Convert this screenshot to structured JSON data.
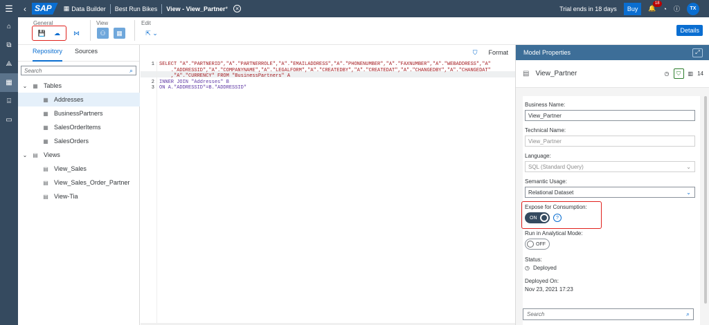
{
  "shell": {
    "logo": "SAP",
    "app": "Data Builder",
    "space": "Best Run Bikes",
    "view_title": "View - View_Partner",
    "view_modified": "*",
    "trial": "Trial ends in 18 days",
    "buy": "Buy",
    "notif_count": "18",
    "user": "TX"
  },
  "toolbar": {
    "general_label": "General",
    "view_label": "View",
    "edit_label": "Edit",
    "details": "Details"
  },
  "repo": {
    "tabs": [
      "Repository",
      "Sources"
    ],
    "search_placeholder": "Search",
    "tables_label": "Tables",
    "tables": [
      "Addresses",
      "BusinessPartners",
      "SalesOrderItems",
      "SalesOrders"
    ],
    "views_label": "Views",
    "views": [
      "View_Sales",
      "View_Sales_Order_Partner",
      "View-Tia"
    ]
  },
  "editor": {
    "format": "Format",
    "lines": [
      {
        "n": "1",
        "t": "SELECT \"A\".\"PARTNERID\",\"A\".\"PARTNERROLE\",\"A\".\"EMAILADDRESS\",\"A\".\"PHONENUMBER\",\"A\".\"FAXNUMBER\",\"A\".\"WEBADDRESS\",\"A\""
      },
      {
        "n": "",
        "t": "    .\"ADDRESSID\",\"A\".\"COMPANYNAME\",\"A\".\"LEGALFORM\",\"A\".\"CREATEDBY\",\"A\".\"CREATEDAT\",\"A\".\"CHANGEDBY\",\"A\".\"CHANGEDAT\""
      },
      {
        "n": "",
        "t": "    ,\"A\".\"CURRENCY\" FROM \"BusinessPartners\" A"
      },
      {
        "n": "2",
        "t": "INNER JOIN \"Addresses\" B"
      },
      {
        "n": "3",
        "t": "ON A.\"ADDRESSID\"=B.\"ADDRESSID\""
      }
    ]
  },
  "props": {
    "header": "Model Properties",
    "name": "View_Partner",
    "count": "14",
    "business_name_label": "Business Name:",
    "business_name": "View_Partner",
    "technical_name_label": "Technical Name:",
    "technical_name": "View_Partner",
    "language_label": "Language:",
    "language": "SQL (Standard Query)",
    "semantic_label": "Semantic Usage:",
    "semantic": "Relational Dataset",
    "expose_label": "Expose for Consumption:",
    "expose_state": "ON",
    "analytical_label": "Run in Analytical Mode:",
    "analytical_state": "OFF",
    "status_label": "Status:",
    "status": "Deployed",
    "deployed_on_label": "Deployed On:",
    "deployed_on": "Nov 23, 2021 17:23",
    "search_placeholder": "Search"
  },
  "colors": {
    "shell": "#354a5f",
    "accent": "#0a6ed1",
    "highlight": "#e0201b"
  }
}
